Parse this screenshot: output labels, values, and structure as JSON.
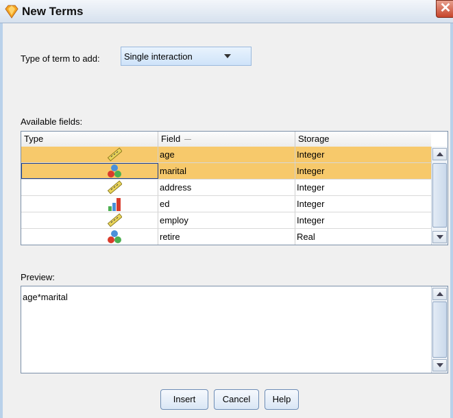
{
  "window": {
    "title": "New Terms",
    "close_label": "✕"
  },
  "term_type": {
    "label": "Type of term to add:",
    "selected": "Single interaction"
  },
  "available_fields": {
    "label": "Available fields:",
    "columns": [
      "Type",
      "Field",
      "Storage"
    ],
    "rows": [
      {
        "type_icon": "ruler-icon",
        "field": "age",
        "storage": "Integer"
      },
      {
        "type_icon": "nominal-icon",
        "field": "marital",
        "storage": "Integer"
      },
      {
        "type_icon": "ruler-icon",
        "field": "address",
        "storage": "Integer"
      },
      {
        "type_icon": "ordinal-icon",
        "field": "ed",
        "storage": "Integer"
      },
      {
        "type_icon": "ruler-icon",
        "field": "employ",
        "storage": "Integer"
      },
      {
        "type_icon": "nominal-icon",
        "field": "retire",
        "storage": "Real"
      }
    ]
  },
  "preview": {
    "label": "Preview:",
    "text": "age*marital"
  },
  "buttons": {
    "insert": "Insert",
    "cancel": "Cancel",
    "help": "Help"
  },
  "colors": {
    "selected_row": "#f7c96b",
    "accent": "#6c8cb5"
  }
}
